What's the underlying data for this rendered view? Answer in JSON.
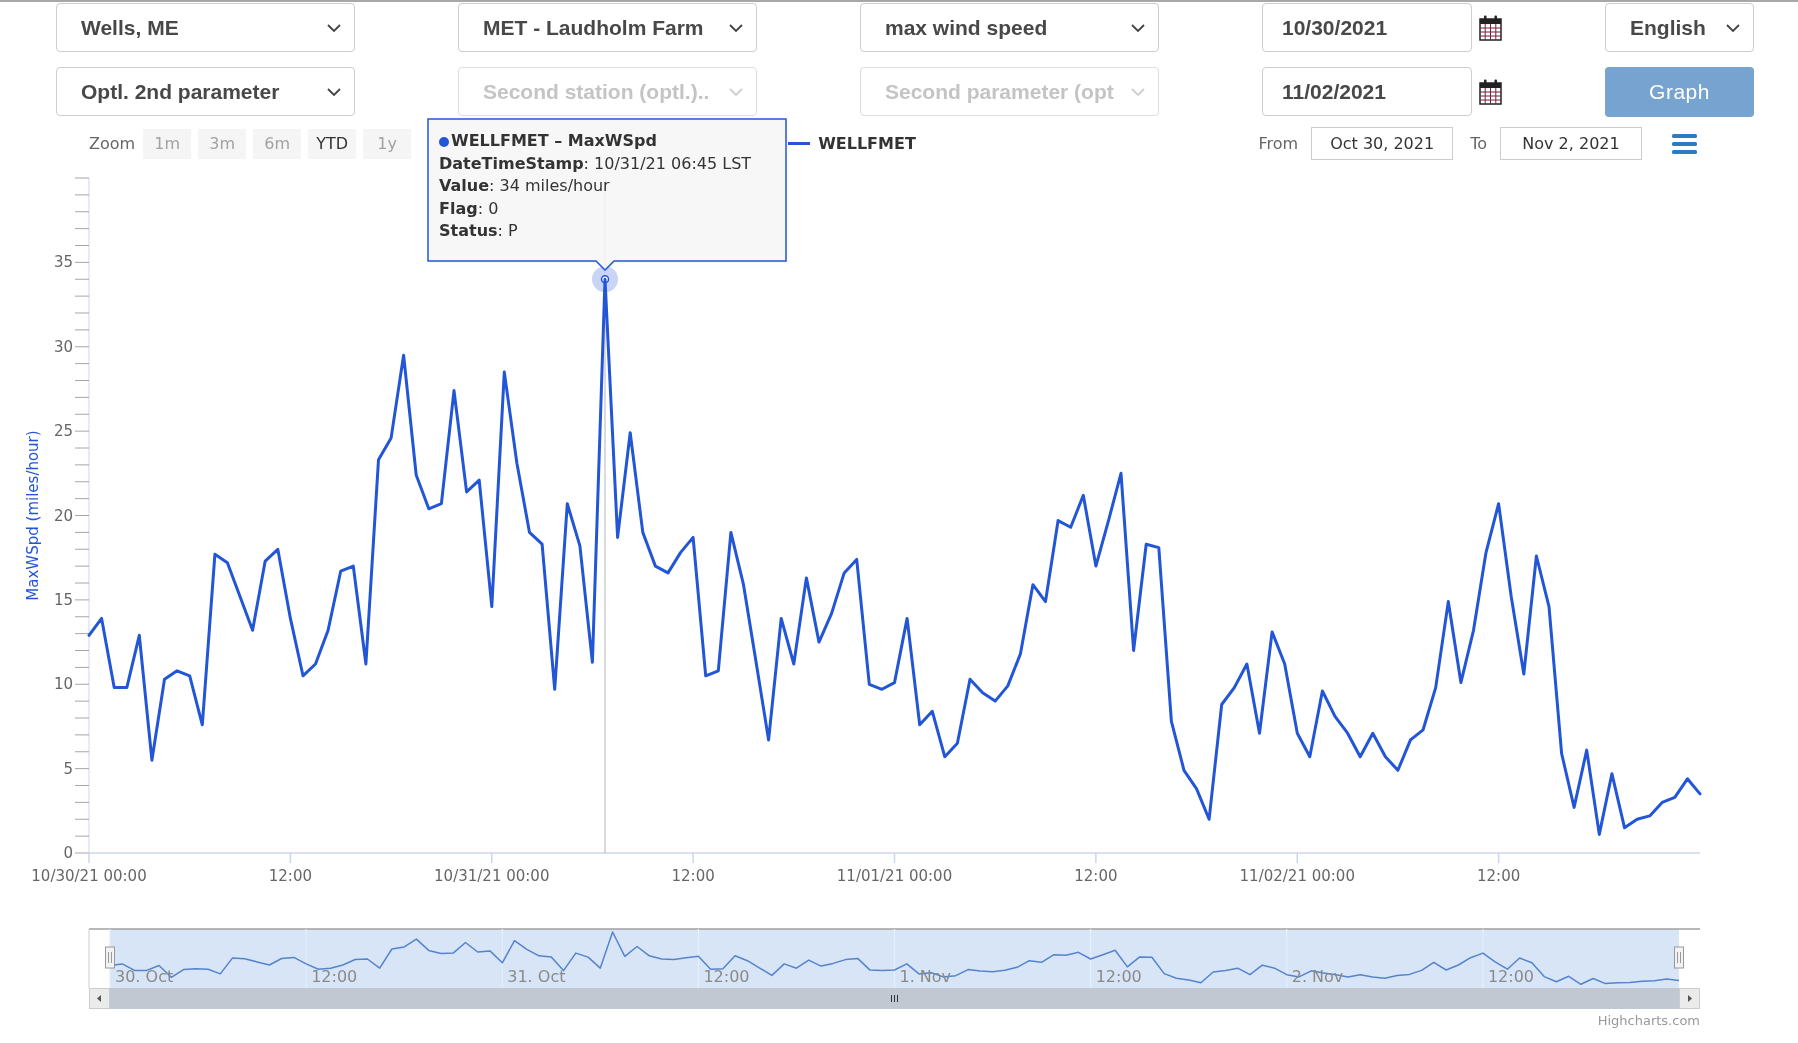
{
  "form": {
    "fields": [
      {
        "kind": "select",
        "value": "Wells, ME",
        "disabled": false
      },
      {
        "kind": "select",
        "value": "MET - Laudholm Farm",
        "disabled": false
      },
      {
        "kind": "select",
        "value": "max wind speed",
        "disabled": false
      },
      {
        "kind": "date",
        "value": "10/30/2021"
      },
      {
        "kind": "select",
        "value": "English",
        "disabled": false
      },
      {
        "kind": "select",
        "value": "Optl. 2nd parameter",
        "disabled": false
      },
      {
        "kind": "select",
        "value": "Second station (optl.)..",
        "disabled": true
      },
      {
        "kind": "select",
        "value": "Second parameter (opt",
        "disabled": true
      },
      {
        "kind": "date",
        "value": "11/02/2021"
      },
      {
        "kind": "button",
        "label": "Graph"
      }
    ]
  },
  "chart": {
    "range_selector": {
      "label": "Zoom",
      "buttons": [
        {
          "label": "1m",
          "disabled": true
        },
        {
          "label": "3m",
          "disabled": true
        },
        {
          "label": "6m",
          "disabled": true
        },
        {
          "label": "YTD",
          "disabled": false
        },
        {
          "label": "1y",
          "disabled": true
        }
      ]
    },
    "date_range": {
      "from_label": "From",
      "from": "Oct 30, 2021",
      "to_label": "To",
      "to": "Nov 2, 2021"
    },
    "tooltip": {
      "title": "WELLFMET – MaxWSpd",
      "lines": [
        "**DateTimeStamp**: 10/31/21 06:45 LST",
        "**Value**: 34 miles/hour",
        "**Flag**: 0",
        "**Status**: P"
      ]
    },
    "chart_data": {
      "type": "line",
      "ylabel": "MaxWSpd (miles/hour)",
      "ylim": [
        0,
        40
      ],
      "yticks": [
        0,
        5,
        10,
        15,
        20,
        25,
        30,
        35
      ],
      "categories": [
        "10/30/21 00:00",
        null,
        null,
        null,
        null,
        null,
        null,
        null,
        null,
        null,
        null,
        null,
        null,
        null,
        null,
        null,
        "12:00",
        null,
        null,
        null,
        null,
        null,
        null,
        null,
        null,
        null,
        null,
        null,
        null,
        null,
        null,
        null,
        "10/31/21 00:00",
        null,
        null,
        null,
        null,
        null,
        null,
        null,
        null,
        null,
        null,
        null,
        null,
        null,
        null,
        null,
        "12:00",
        null,
        null,
        null,
        null,
        null,
        null,
        null,
        null,
        null,
        null,
        null,
        null,
        null,
        null,
        null,
        "11/01/21 00:00",
        null,
        null,
        null,
        null,
        null,
        null,
        null,
        null,
        null,
        null,
        null,
        null,
        null,
        null,
        null,
        "12:00",
        null,
        null,
        null,
        null,
        null,
        null,
        null,
        null,
        null,
        null,
        null,
        null,
        null,
        null,
        null,
        "11/02/21 00:00",
        null,
        null,
        null,
        null,
        null,
        null,
        null,
        null,
        null,
        null,
        null,
        null,
        null,
        null,
        null,
        "12:00",
        null,
        null,
        null,
        null,
        null,
        null,
        null,
        null,
        null,
        null,
        null,
        null,
        null,
        null,
        null,
        null
      ],
      "series": [
        {
          "name": "WELLFMET",
          "color": "#2356d6",
          "values": [
            12.9,
            13.9,
            9.8,
            9.8,
            12.9,
            5.5,
            10.3,
            10.8,
            10.5,
            7.6,
            17.7,
            17.2,
            15.2,
            13.2,
            17.3,
            18.0,
            13.9,
            10.5,
            11.2,
            13.2,
            16.7,
            17.0,
            11.2,
            23.3,
            24.6,
            29.5,
            22.4,
            20.4,
            20.7,
            27.4,
            21.4,
            22.1,
            14.6,
            28.5,
            23.1,
            19.0,
            18.3,
            9.7,
            20.7,
            18.2,
            11.3,
            34,
            18.7,
            24.9,
            19.0,
            17.0,
            16.6,
            17.8,
            18.7,
            10.5,
            10.8,
            19.0,
            15.9,
            11.3,
            6.7,
            13.9,
            11.2,
            16.3,
            12.5,
            14.2,
            16.6,
            17.4,
            10.0,
            9.7,
            10.1,
            13.9,
            7.6,
            8.4,
            5.7,
            6.5,
            10.3,
            9.5,
            9.0,
            9.9,
            11.8,
            15.9,
            14.9,
            19.7,
            19.3,
            21.2,
            17.0,
            19.7,
            22.5,
            12.0,
            18.3,
            18.1,
            7.8,
            4.9,
            3.8,
            2.0,
            8.8,
            9.8,
            11.2,
            7.1,
            13.1,
            11.2,
            7.1,
            5.7,
            9.6,
            8.1,
            7.1,
            5.7,
            7.1,
            5.7,
            4.9,
            6.7,
            7.3,
            9.8,
            14.9,
            10.1,
            13.2,
            17.8,
            20.7,
            15.2,
            10.6,
            17.6,
            14.6,
            5.9,
            2.7,
            6.1,
            1.1,
            4.7,
            1.5,
            2.0,
            2.2,
            3.0,
            3.3,
            4.4,
            3.5
          ]
        }
      ]
    },
    "navigator": {
      "labels": [
        "30. Oct",
        "12:00",
        "31. Oct",
        "12:00",
        "1. Nov",
        "12:00",
        "2. Nov",
        "12:00"
      ]
    },
    "credits": "Highcharts.com"
  }
}
